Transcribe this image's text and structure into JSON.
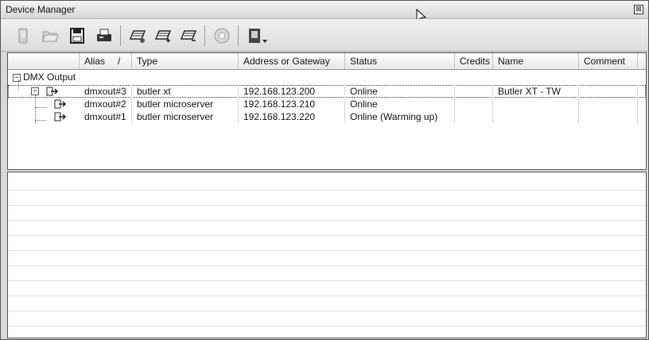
{
  "window": {
    "title": "Device Manager",
    "close_glyph": "⊠"
  },
  "toolbar": {
    "buttons": [
      {
        "name": "mobile-device-icon"
      },
      {
        "name": "open-folder-icon"
      },
      {
        "name": "save-disk-icon"
      },
      {
        "name": "fax-icon"
      },
      {
        "name": "keyboard-edit-icon"
      },
      {
        "name": "keyboard-add-icon"
      },
      {
        "name": "keyboard-remove-icon"
      },
      {
        "name": "refresh-disc-icon"
      },
      {
        "name": "dmx-dropdown-icon"
      }
    ]
  },
  "table": {
    "columns": [
      "Alias",
      "Type",
      "Address or Gateway",
      "Status",
      "Credits",
      "Name",
      "Comment"
    ],
    "sort_indicator": "/",
    "group": {
      "label": "DMX Output",
      "expander": "−"
    },
    "rows": [
      {
        "alias": "dmxout#3",
        "type": "butler xt",
        "address": "192.168.123.200",
        "status": "Online",
        "credits": "",
        "name": "Butler XT - TW",
        "comment": "",
        "expander": "−"
      },
      {
        "alias": "dmxout#2",
        "type": "butler microserver",
        "address": "192.168.123.210",
        "status": "Online",
        "credits": "",
        "name": "",
        "comment": ""
      },
      {
        "alias": "dmxout#1",
        "type": "butler microserver",
        "address": "192.168.123.220",
        "status": "Online (Warming up)",
        "credits": "",
        "name": "",
        "comment": ""
      }
    ]
  }
}
